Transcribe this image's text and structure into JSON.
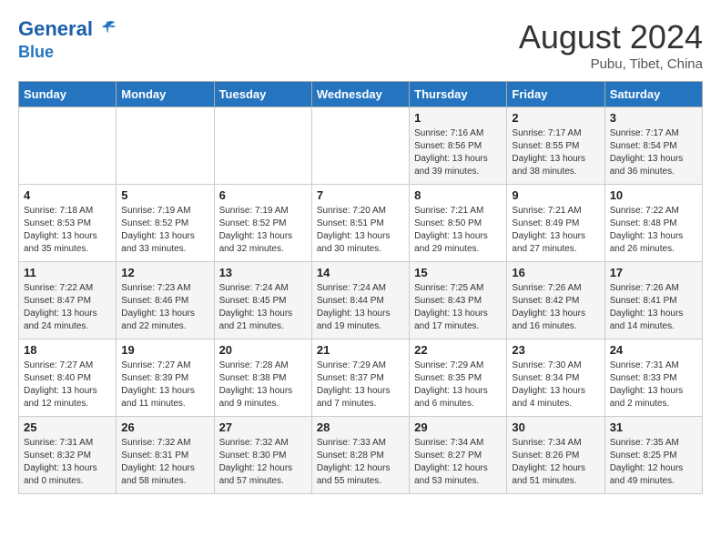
{
  "header": {
    "logo_line1": "General",
    "logo_line2": "Blue",
    "month_year": "August 2024",
    "location": "Pubu, Tibet, China"
  },
  "weekdays": [
    "Sunday",
    "Monday",
    "Tuesday",
    "Wednesday",
    "Thursday",
    "Friday",
    "Saturday"
  ],
  "weeks": [
    [
      {
        "day": "",
        "detail": ""
      },
      {
        "day": "",
        "detail": ""
      },
      {
        "day": "",
        "detail": ""
      },
      {
        "day": "",
        "detail": ""
      },
      {
        "day": "1",
        "detail": "Sunrise: 7:16 AM\nSunset: 8:56 PM\nDaylight: 13 hours\nand 39 minutes."
      },
      {
        "day": "2",
        "detail": "Sunrise: 7:17 AM\nSunset: 8:55 PM\nDaylight: 13 hours\nand 38 minutes."
      },
      {
        "day": "3",
        "detail": "Sunrise: 7:17 AM\nSunset: 8:54 PM\nDaylight: 13 hours\nand 36 minutes."
      }
    ],
    [
      {
        "day": "4",
        "detail": "Sunrise: 7:18 AM\nSunset: 8:53 PM\nDaylight: 13 hours\nand 35 minutes."
      },
      {
        "day": "5",
        "detail": "Sunrise: 7:19 AM\nSunset: 8:52 PM\nDaylight: 13 hours\nand 33 minutes."
      },
      {
        "day": "6",
        "detail": "Sunrise: 7:19 AM\nSunset: 8:52 PM\nDaylight: 13 hours\nand 32 minutes."
      },
      {
        "day": "7",
        "detail": "Sunrise: 7:20 AM\nSunset: 8:51 PM\nDaylight: 13 hours\nand 30 minutes."
      },
      {
        "day": "8",
        "detail": "Sunrise: 7:21 AM\nSunset: 8:50 PM\nDaylight: 13 hours\nand 29 minutes."
      },
      {
        "day": "9",
        "detail": "Sunrise: 7:21 AM\nSunset: 8:49 PM\nDaylight: 13 hours\nand 27 minutes."
      },
      {
        "day": "10",
        "detail": "Sunrise: 7:22 AM\nSunset: 8:48 PM\nDaylight: 13 hours\nand 26 minutes."
      }
    ],
    [
      {
        "day": "11",
        "detail": "Sunrise: 7:22 AM\nSunset: 8:47 PM\nDaylight: 13 hours\nand 24 minutes."
      },
      {
        "day": "12",
        "detail": "Sunrise: 7:23 AM\nSunset: 8:46 PM\nDaylight: 13 hours\nand 22 minutes."
      },
      {
        "day": "13",
        "detail": "Sunrise: 7:24 AM\nSunset: 8:45 PM\nDaylight: 13 hours\nand 21 minutes."
      },
      {
        "day": "14",
        "detail": "Sunrise: 7:24 AM\nSunset: 8:44 PM\nDaylight: 13 hours\nand 19 minutes."
      },
      {
        "day": "15",
        "detail": "Sunrise: 7:25 AM\nSunset: 8:43 PM\nDaylight: 13 hours\nand 17 minutes."
      },
      {
        "day": "16",
        "detail": "Sunrise: 7:26 AM\nSunset: 8:42 PM\nDaylight: 13 hours\nand 16 minutes."
      },
      {
        "day": "17",
        "detail": "Sunrise: 7:26 AM\nSunset: 8:41 PM\nDaylight: 13 hours\nand 14 minutes."
      }
    ],
    [
      {
        "day": "18",
        "detail": "Sunrise: 7:27 AM\nSunset: 8:40 PM\nDaylight: 13 hours\nand 12 minutes."
      },
      {
        "day": "19",
        "detail": "Sunrise: 7:27 AM\nSunset: 8:39 PM\nDaylight: 13 hours\nand 11 minutes."
      },
      {
        "day": "20",
        "detail": "Sunrise: 7:28 AM\nSunset: 8:38 PM\nDaylight: 13 hours\nand 9 minutes."
      },
      {
        "day": "21",
        "detail": "Sunrise: 7:29 AM\nSunset: 8:37 PM\nDaylight: 13 hours\nand 7 minutes."
      },
      {
        "day": "22",
        "detail": "Sunrise: 7:29 AM\nSunset: 8:35 PM\nDaylight: 13 hours\nand 6 minutes."
      },
      {
        "day": "23",
        "detail": "Sunrise: 7:30 AM\nSunset: 8:34 PM\nDaylight: 13 hours\nand 4 minutes."
      },
      {
        "day": "24",
        "detail": "Sunrise: 7:31 AM\nSunset: 8:33 PM\nDaylight: 13 hours\nand 2 minutes."
      }
    ],
    [
      {
        "day": "25",
        "detail": "Sunrise: 7:31 AM\nSunset: 8:32 PM\nDaylight: 13 hours\nand 0 minutes."
      },
      {
        "day": "26",
        "detail": "Sunrise: 7:32 AM\nSunset: 8:31 PM\nDaylight: 12 hours\nand 58 minutes."
      },
      {
        "day": "27",
        "detail": "Sunrise: 7:32 AM\nSunset: 8:30 PM\nDaylight: 12 hours\nand 57 minutes."
      },
      {
        "day": "28",
        "detail": "Sunrise: 7:33 AM\nSunset: 8:28 PM\nDaylight: 12 hours\nand 55 minutes."
      },
      {
        "day": "29",
        "detail": "Sunrise: 7:34 AM\nSunset: 8:27 PM\nDaylight: 12 hours\nand 53 minutes."
      },
      {
        "day": "30",
        "detail": "Sunrise: 7:34 AM\nSunset: 8:26 PM\nDaylight: 12 hours\nand 51 minutes."
      },
      {
        "day": "31",
        "detail": "Sunrise: 7:35 AM\nSunset: 8:25 PM\nDaylight: 12 hours\nand 49 minutes."
      }
    ]
  ]
}
